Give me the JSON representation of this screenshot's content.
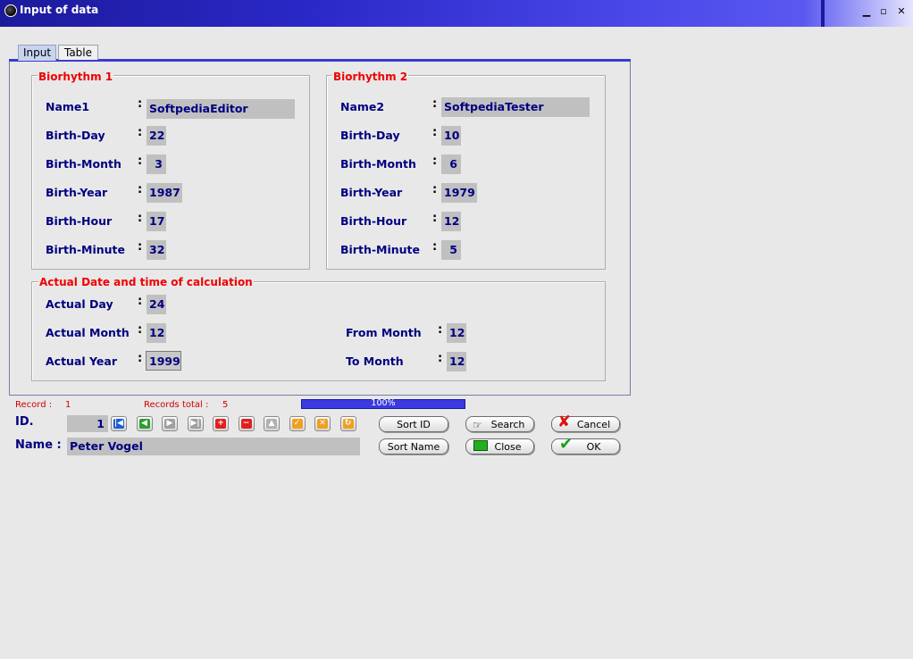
{
  "window": {
    "title": "Input of data",
    "min": "▁",
    "max": "▫",
    "close": "✕"
  },
  "tabs": [
    {
      "label": "Input"
    },
    {
      "label": "Table"
    }
  ],
  "biorhythm1": {
    "title": "Biorhythm 1",
    "rows": [
      {
        "label": "Name1",
        "value": "SoftpediaEditor"
      },
      {
        "label": "Birth-Day",
        "value": "22"
      },
      {
        "label": "Birth-Month",
        "value": "3"
      },
      {
        "label": "Birth-Year",
        "value": "1987"
      },
      {
        "label": "Birth-Hour",
        "value": "17"
      },
      {
        "label": "Birth-Minute",
        "value": "32"
      }
    ]
  },
  "biorhythm2": {
    "title": "Biorhythm 2",
    "rows": [
      {
        "label": "Name2",
        "value": "SoftpediaTester"
      },
      {
        "label": "Birth-Day",
        "value": "10"
      },
      {
        "label": "Birth-Month",
        "value": "6"
      },
      {
        "label": "Birth-Year",
        "value": "1979"
      },
      {
        "label": "Birth-Hour",
        "value": "12"
      },
      {
        "label": "Birth-Minute",
        "value": "5"
      }
    ]
  },
  "actual": {
    "title": "Actual Date and time of calculation",
    "day": {
      "label": "Actual Day",
      "value": "24"
    },
    "month": {
      "label": "Actual Month",
      "value": "12"
    },
    "year": {
      "label": "Actual Year",
      "value": "1999"
    },
    "from_month": {
      "label": "From Month",
      "value": "12"
    },
    "to_month": {
      "label": "To Month",
      "value": "12"
    }
  },
  "colon": ":",
  "status": {
    "record_label": "Record :",
    "record_value": "1",
    "total_label": "Records total :",
    "total_value": "5",
    "progress_text": "100%",
    "progress_fraction": 1.0
  },
  "record": {
    "id_label": "ID.",
    "id_value": "1",
    "name_label": "Name :",
    "name_value": "Peter Vogel"
  },
  "nav_icons": [
    {
      "name": "first-record-icon",
      "glyph": "|◀",
      "color": "#1e5bd6"
    },
    {
      "name": "previous-record-icon",
      "glyph": "◀",
      "color": "#2aa02a"
    },
    {
      "name": "next-record-icon",
      "glyph": "▶",
      "color": "#a0a0a0"
    },
    {
      "name": "last-record-icon",
      "glyph": "▶|",
      "color": "#a0a0a0"
    },
    {
      "name": "add-record-icon",
      "glyph": "+",
      "color": "#e02020"
    },
    {
      "name": "delete-record-icon",
      "glyph": "−",
      "color": "#e02020"
    },
    {
      "name": "edit-record-icon",
      "glyph": "▲",
      "color": "#b0b0b0"
    },
    {
      "name": "post-record-icon",
      "glyph": "✓",
      "color": "#f0a020"
    },
    {
      "name": "cancel-edit-icon",
      "glyph": "✕",
      "color": "#f0a020"
    },
    {
      "name": "refresh-icon",
      "glyph": "↻",
      "color": "#f0a020"
    }
  ],
  "buttons": {
    "sort_id": "Sort ID",
    "sort_name": "Sort Name",
    "search": "Search",
    "close": "Close",
    "cancel": "Cancel",
    "ok": "OK"
  }
}
